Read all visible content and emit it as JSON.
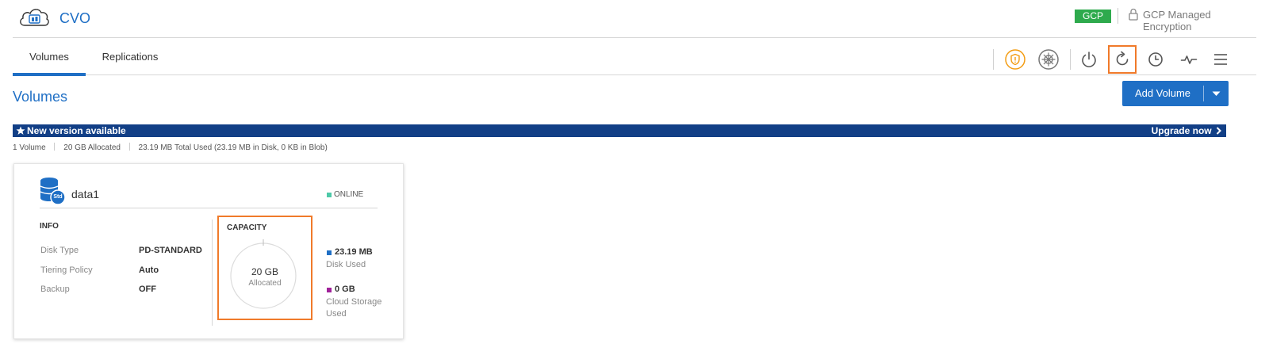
{
  "app": {
    "title": "CVO"
  },
  "header": {
    "cloud_badge": "GCP",
    "encryption_label": "GCP Managed Encryption"
  },
  "tabs": [
    {
      "label": "Volumes"
    },
    {
      "label": "Replications"
    }
  ],
  "toolbar": {
    "icons": [
      "shield-icon",
      "kubernetes-icon",
      "power-icon",
      "refresh-icon",
      "clock-icon",
      "activity-icon",
      "menu-icon"
    ],
    "accent_color": "#f39c12",
    "highlight_color": "#f07a2a"
  },
  "page": {
    "title": "Volumes",
    "add_button_label": "Add Volume"
  },
  "banner": {
    "text": "New version available",
    "action_label": "Upgrade now"
  },
  "summary": {
    "volume_count": "1 Volume",
    "allocated": "20 GB Allocated",
    "total_used": "23.19 MB Total Used (23.19 MB in Disk, 0 KB in Blob)"
  },
  "volume_card": {
    "name": "data1",
    "icon_badge": "Std",
    "status": "ONLINE",
    "status_color": "#4ec9a8",
    "info": {
      "title": "INFO",
      "rows": [
        {
          "key": "Disk Type",
          "value": "PD-STANDARD"
        },
        {
          "key": "Tiering Policy",
          "value": "Auto"
        },
        {
          "key": "Backup",
          "value": "OFF"
        }
      ]
    },
    "capacity": {
      "title": "CAPACITY",
      "allocated_value": "20 GB",
      "allocated_label": "Allocated",
      "legend": [
        {
          "value": "23.19 MB",
          "label": "Disk Used",
          "color": "#1f6fc5"
        },
        {
          "value": "0 GB",
          "label": "Cloud Storage Used",
          "color": "#a0229a"
        }
      ]
    }
  },
  "colors": {
    "brand_blue": "#1f6fc5",
    "banner_blue": "#123f86",
    "gcp_green": "#2eaa4d"
  }
}
